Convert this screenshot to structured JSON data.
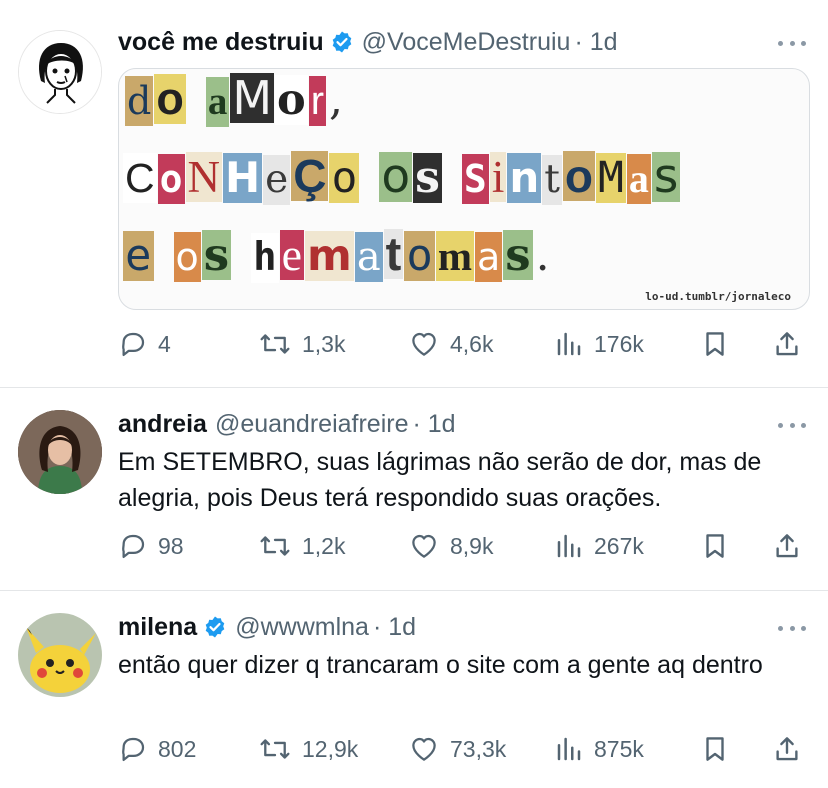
{
  "tweets": [
    {
      "name": "você me destruiu",
      "handle": "@VoceMeDestruiu",
      "time": "· 1d",
      "verified": true,
      "media": {
        "line1": [
          "d",
          "o",
          " ",
          "a",
          "M",
          "o",
          "r",
          ","
        ],
        "line2": [
          "C",
          "o",
          "N",
          "H",
          "e",
          "Ç",
          "o",
          " ",
          "o",
          "s",
          " ",
          "S",
          "i",
          "n",
          "t",
          "o",
          "M",
          "a",
          "s"
        ],
        "line3": [
          "e",
          " ",
          "o",
          "s",
          " ",
          "h",
          "e",
          "m",
          "a",
          "t",
          "o",
          "m",
          "a",
          "s",
          "."
        ],
        "credit": "lo-ud.tumblr/jornaleco"
      },
      "replies": "4",
      "retweets": "1,3k",
      "likes": "4,6k",
      "views": "176k"
    },
    {
      "name": "andreia",
      "handle": "@euandreiafreire",
      "time": "· 1d",
      "verified": false,
      "text": "Em SETEMBRO, suas lágrimas não serão de dor, mas de alegria, pois Deus terá respondido suas orações.",
      "replies": "98",
      "retweets": "1,2k",
      "likes": "8,9k",
      "views": "267k"
    },
    {
      "name": "milena",
      "handle": "@wwwmlna",
      "time": "· 1d",
      "verified": true,
      "text": "então quer dizer q trancaram o site com a gente aq dentro",
      "replies": "802",
      "retweets": "12,9k",
      "likes": "73,3k",
      "views": "875k"
    }
  ],
  "colors": {
    "verified": "#1d9bf0",
    "muted": "#536471",
    "text": "#0f1419"
  }
}
